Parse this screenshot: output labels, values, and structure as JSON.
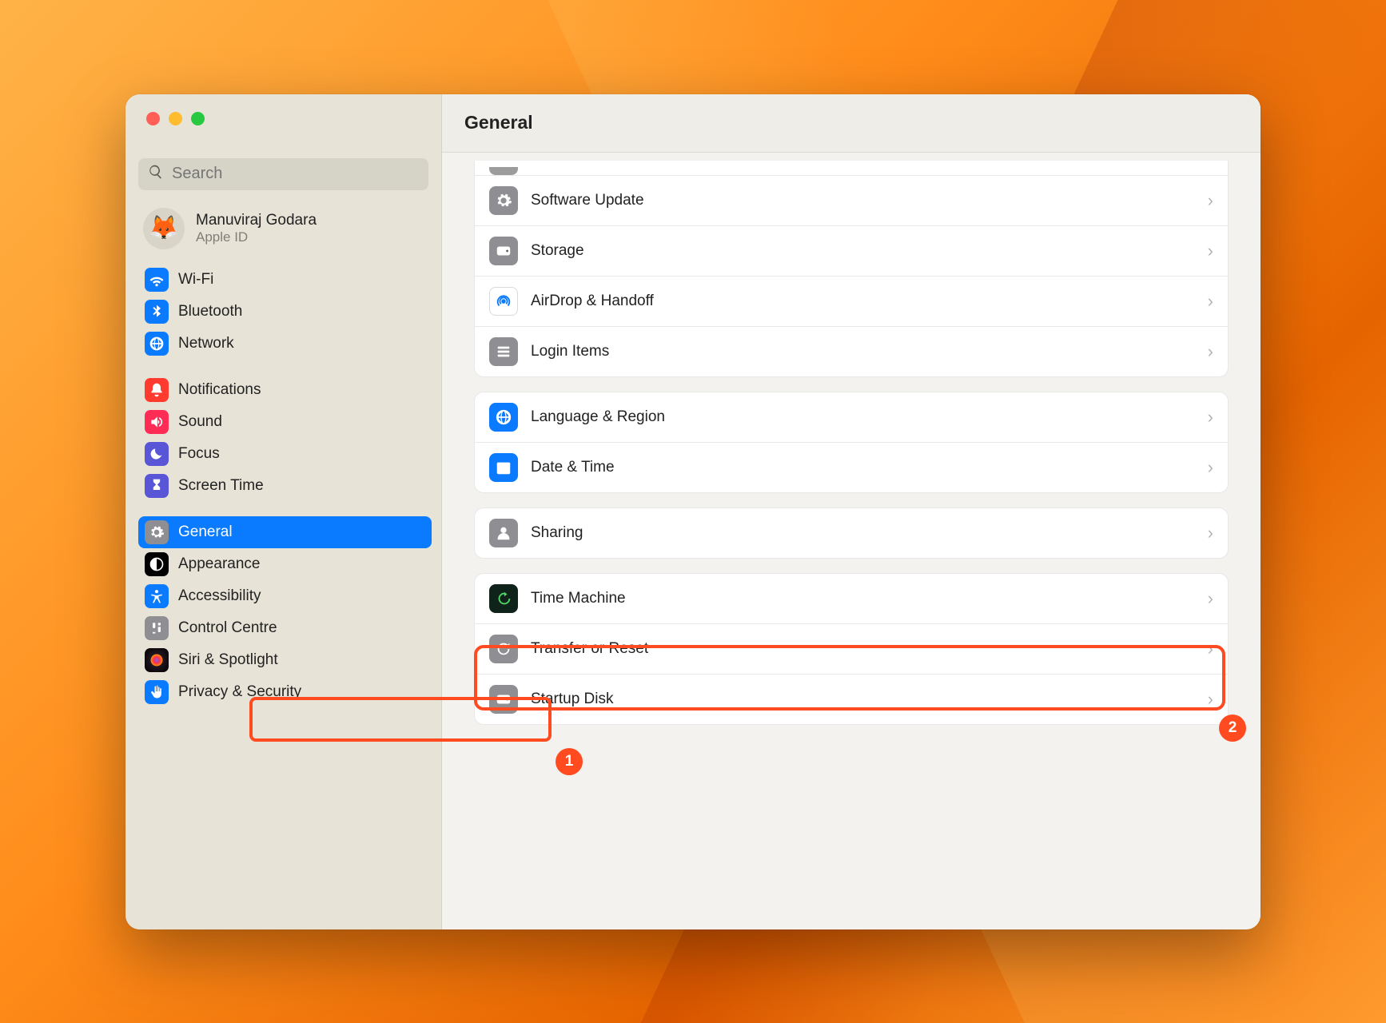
{
  "header": {
    "title": "General"
  },
  "search": {
    "placeholder": "Search"
  },
  "account": {
    "name": "Manuviraj Godara",
    "sub": "Apple ID",
    "avatar_emoji": "🦊"
  },
  "sidebar": {
    "groups": [
      [
        {
          "label": "Wi-Fi",
          "color": "#0a7aff",
          "icon": "wifi"
        },
        {
          "label": "Bluetooth",
          "color": "#0a7aff",
          "icon": "bluetooth"
        },
        {
          "label": "Network",
          "color": "#0a7aff",
          "icon": "globe"
        }
      ],
      [
        {
          "label": "Notifications",
          "color": "#ff3b30",
          "icon": "bell"
        },
        {
          "label": "Sound",
          "color": "#ff2d55",
          "icon": "speaker"
        },
        {
          "label": "Focus",
          "color": "#5856d6",
          "icon": "moon"
        },
        {
          "label": "Screen Time",
          "color": "#5856d6",
          "icon": "hourglass"
        }
      ],
      [
        {
          "label": "General",
          "color": "#8e8e93",
          "icon": "gear",
          "selected": true
        },
        {
          "label": "Appearance",
          "color": "#000000",
          "icon": "appearance"
        },
        {
          "label": "Accessibility",
          "color": "#0a7aff",
          "icon": "accessibility"
        },
        {
          "label": "Control Centre",
          "color": "#8e8e93",
          "icon": "control"
        },
        {
          "label": "Siri & Spotlight",
          "color": "gradient",
          "icon": "siri"
        },
        {
          "label": "Privacy & Security",
          "color": "#0a7aff",
          "icon": "hand"
        }
      ]
    ]
  },
  "main": {
    "sections": [
      [
        {
          "label": "Software Update",
          "color": "#8e8e93",
          "icon": "gear"
        },
        {
          "label": "Storage",
          "color": "#8e8e93",
          "icon": "disk"
        },
        {
          "label": "AirDrop & Handoff",
          "color": "#ffffff",
          "icon": "airdrop",
          "iconColor": "#0a7aff",
          "border": true
        },
        {
          "label": "Login Items",
          "color": "#8e8e93",
          "icon": "list"
        }
      ],
      [
        {
          "label": "Language & Region",
          "color": "#0a7aff",
          "icon": "globe"
        },
        {
          "label": "Date & Time",
          "color": "#0a7aff",
          "icon": "calendar"
        }
      ],
      [
        {
          "label": "Sharing",
          "color": "#8e8e93",
          "icon": "person"
        }
      ],
      [
        {
          "label": "Time Machine",
          "color": "#10231a",
          "icon": "clockback"
        },
        {
          "label": "Transfer or Reset",
          "color": "#8e8e93",
          "icon": "reset"
        },
        {
          "label": "Startup Disk",
          "color": "#8e8e93",
          "icon": "disk"
        }
      ]
    ]
  },
  "annotations": {
    "badge1": "1",
    "badge2": "2"
  }
}
